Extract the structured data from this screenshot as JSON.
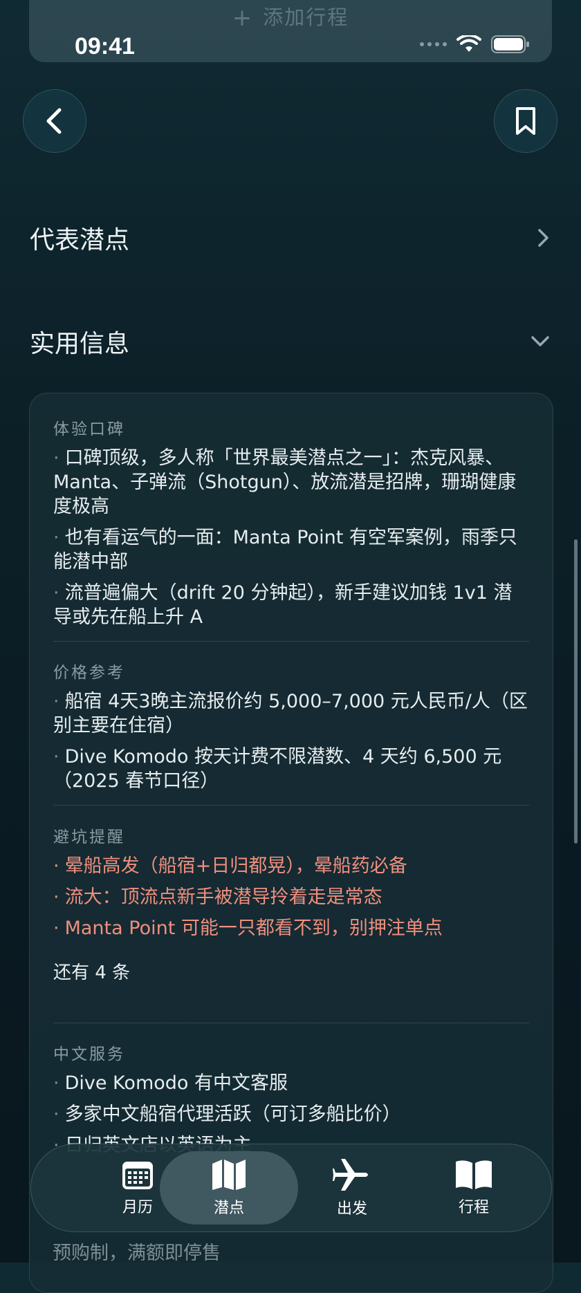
{
  "status_bar": {
    "time": "09:41"
  },
  "top_button": {
    "label": "添加行程"
  },
  "sections": [
    {
      "title": "代表潜点",
      "state": "collapsed"
    },
    {
      "title": "实用信息",
      "state": "expanded"
    }
  ],
  "info": {
    "experience": {
      "label": "体验口碑",
      "items": [
        "口碑顶级，多人称「世界最美潜点之一」：杰克风暴、Manta、子弹流（Shotgun）、放流潜是招牌，珊瑚健康度极高",
        "也有看运气的一面：Manta Point 有空军案例，雨季只能潜中部",
        "流普遍偏大（drift 20 分钟起），新手建议加钱 1v1 潜导或先在船上升 A"
      ]
    },
    "price": {
      "label": "价格参考",
      "items": [
        "船宿 4天3晚主流报价约 5,000–7,000 元人民币/人（区别主要在住宿）",
        "Dive Komodo 按天计费不限潜数、4 天约 6,500 元（2025 春节口径）"
      ]
    },
    "pitfalls": {
      "label": "避坑提醒",
      "items": [
        "晕船高发（船宿+日归都晃），晕船药必备",
        "流大：顶流点新手被潜导拎着走是常态",
        "Manta Point 可能一只都看不到，别押注单点"
      ],
      "more": "还有 4 条"
    },
    "chinese": {
      "label": "中文服务",
      "items": [
        "Dive Komodo 有中文客服",
        "多家中文船宿代理活跃（可订多船比价）",
        "日归英文店以英语为主"
      ]
    },
    "footer_partial": "预购制，满额即停售"
  },
  "tabs": [
    {
      "label": "月历",
      "icon": "calendar-icon",
      "active": false
    },
    {
      "label": "潜点",
      "icon": "map-icon",
      "active": true
    },
    {
      "label": "出发",
      "icon": "airplane-icon",
      "active": false
    },
    {
      "label": "行程",
      "icon": "book-icon",
      "active": false
    }
  ]
}
